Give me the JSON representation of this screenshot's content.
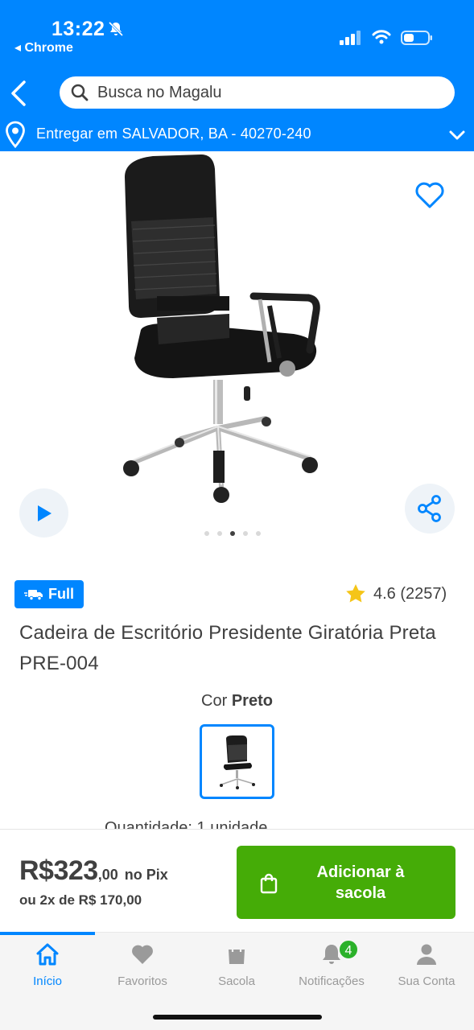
{
  "status_bar": {
    "time": "13:22",
    "back_app": "◂ Chrome"
  },
  "header": {
    "search_placeholder": "Busca no Magalu",
    "location": "Entregar em SALVADOR, BA - 40270-240"
  },
  "product": {
    "badge": "Full",
    "rating": "4.6 (2257)",
    "title": "Cadeira de Escritório Presidente Giratória Preta PRE-004",
    "color_prefix": "Cor",
    "color_value": "Preto",
    "image_dots_total": 5,
    "image_dots_active": 3,
    "quantity_peek": "Quantidade: 1 unidade"
  },
  "price": {
    "value": "R$323",
    "cents": ",00",
    "pix_label": "no Pix",
    "installments": "ou 2x de R$ 170,00",
    "add_button_label": "Adicionar à\nsacola"
  },
  "nav": {
    "items": [
      {
        "label": "Início",
        "icon": "home-icon",
        "active": true
      },
      {
        "label": "Favoritos",
        "icon": "heart-icon"
      },
      {
        "label": "Sacola",
        "icon": "bag-icon"
      },
      {
        "label": "Notificações",
        "icon": "bell-icon",
        "badge": "4"
      },
      {
        "label": "Sua Conta",
        "icon": "user-icon"
      }
    ]
  },
  "colors": {
    "brand_blue": "#0086ff",
    "buy_green": "#45ac07",
    "star_yellow": "#f5c518",
    "badge_green": "#2bb12a"
  }
}
